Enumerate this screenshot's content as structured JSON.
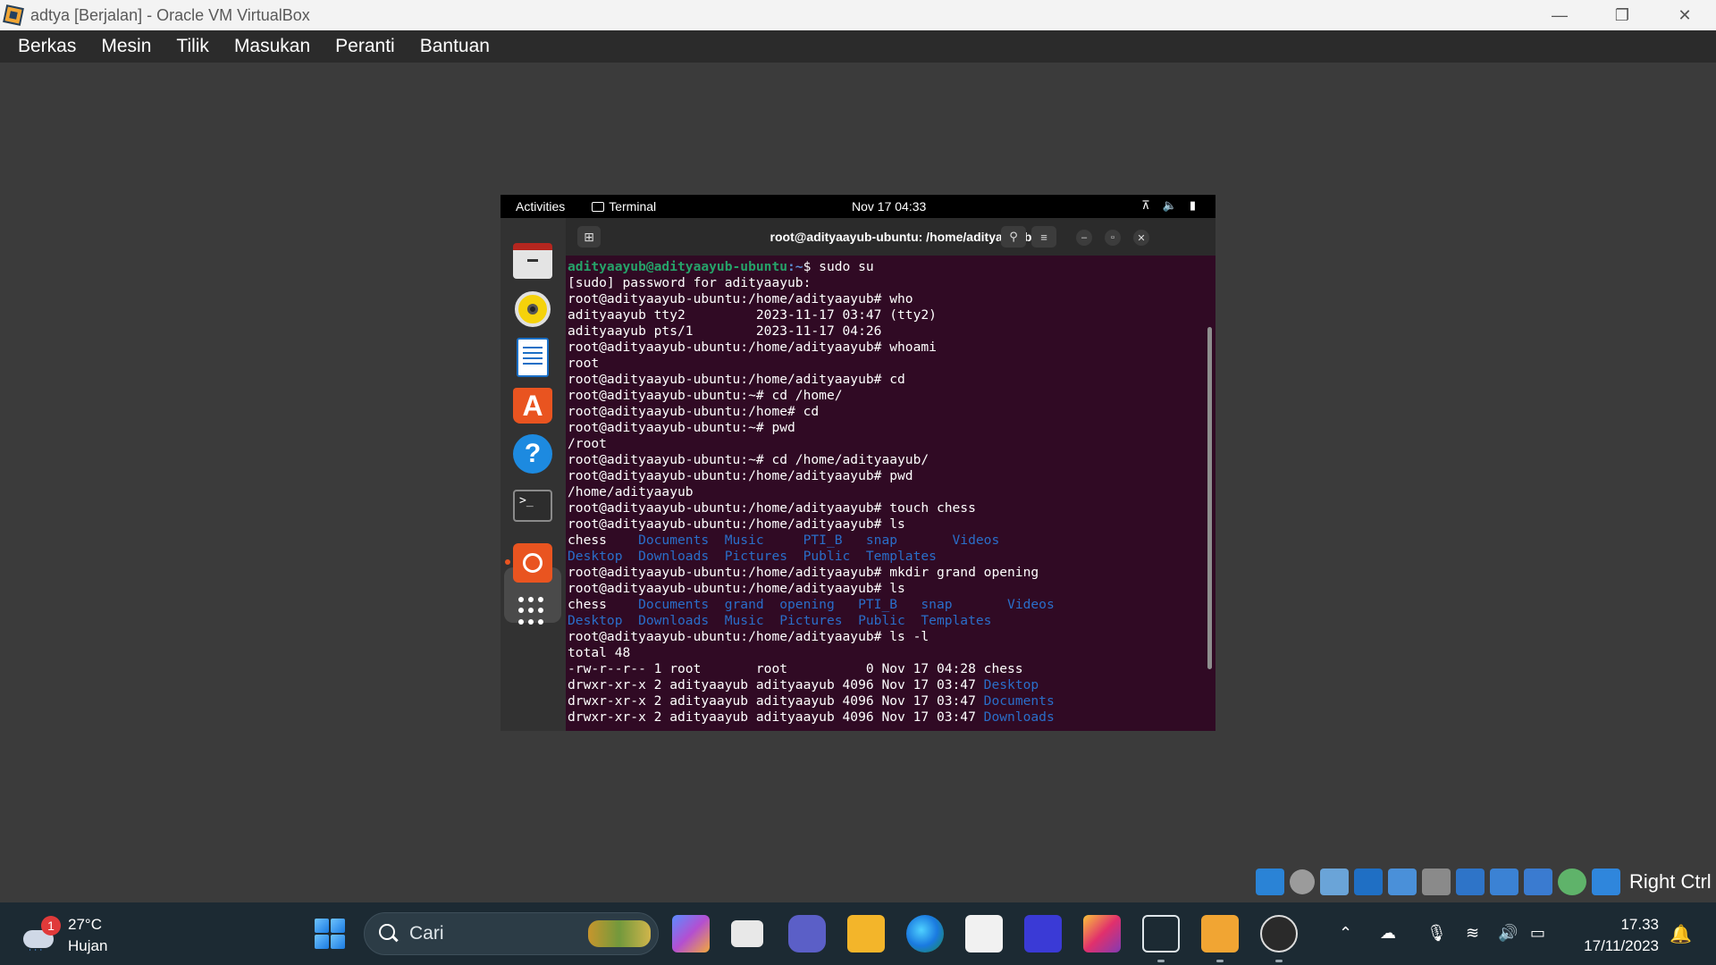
{
  "host_window": {
    "title": "adtya [Berjalan] - Oracle VM VirtualBox",
    "controls": {
      "minimize": "—",
      "restore": "❐",
      "close": "✕"
    }
  },
  "vbox_menu": [
    "Berkas",
    "Mesin",
    "Tilik",
    "Masukan",
    "Peranti",
    "Bantuan"
  ],
  "gnome": {
    "activities": "Activities",
    "app_name": "Terminal",
    "clock": "Nov 17  04:33"
  },
  "terminal": {
    "title": "root@adityaayub-ubuntu: /home/adityaayub",
    "first_prompt_user": "adityaayub@adityaayub-ubuntu",
    "first_prompt_path": ":~",
    "first_command": "$ sudo su",
    "lines": [
      "[sudo] password for adityaayub:",
      "root@adityaayub-ubuntu:/home/adityaayub# who",
      "adityaayub tty2         2023-11-17 03:47 (tty2)",
      "adityaayub pts/1        2023-11-17 04:26",
      "root@adityaayub-ubuntu:/home/adityaayub# whoami",
      "root",
      "root@adityaayub-ubuntu:/home/adityaayub# cd",
      "root@adityaayub-ubuntu:~# cd /home/",
      "root@adityaayub-ubuntu:/home# cd",
      "root@adityaayub-ubuntu:~# pwd",
      "/root",
      "root@adityaayub-ubuntu:~# cd /home/adityaayub/",
      "root@adityaayub-ubuntu:/home/adityaayub# pwd",
      "/home/adityaayub",
      "root@adityaayub-ubuntu:/home/adityaayub# touch chess",
      "root@adityaayub-ubuntu:/home/adityaayub# ls"
    ],
    "ls1_file": "chess    ",
    "ls1_row1_dirs": "Documents  Music     PTI_B   snap       Videos",
    "ls1_row2_dirs": "Desktop  Downloads  Pictures  Public  Templates",
    "lines2": [
      "root@adityaayub-ubuntu:/home/adityaayub# mkdir grand opening",
      "root@adityaayub-ubuntu:/home/adityaayub# ls"
    ],
    "ls2_file": "chess    ",
    "ls2_row1_dirs": "Documents  grand  opening   PTI_B   snap       Videos",
    "ls2_row2_dirs": "Desktop  Downloads  Music  Pictures  Public  Templates",
    "lines3": [
      "root@adityaayub-ubuntu:/home/adityaayub# ls -l",
      "total 48",
      "-rw-r--r-- 1 root       root          0 Nov 17 04:28 chess"
    ],
    "ll_prefix": "drwxr-xr-x 2 adityaayub adityaayub 4096 Nov 17 03:47 ",
    "ll_dirs": [
      "Desktop",
      "Documents",
      "Downloads"
    ]
  },
  "vbox_status": {
    "host_key": "Right Ctrl"
  },
  "taskbar": {
    "weather_temp": "27°C",
    "weather_desc": "Hujan",
    "weather_badge": "1",
    "search_placeholder": "Cari",
    "clock_time": "17.33",
    "clock_date": "17/11/2023"
  }
}
